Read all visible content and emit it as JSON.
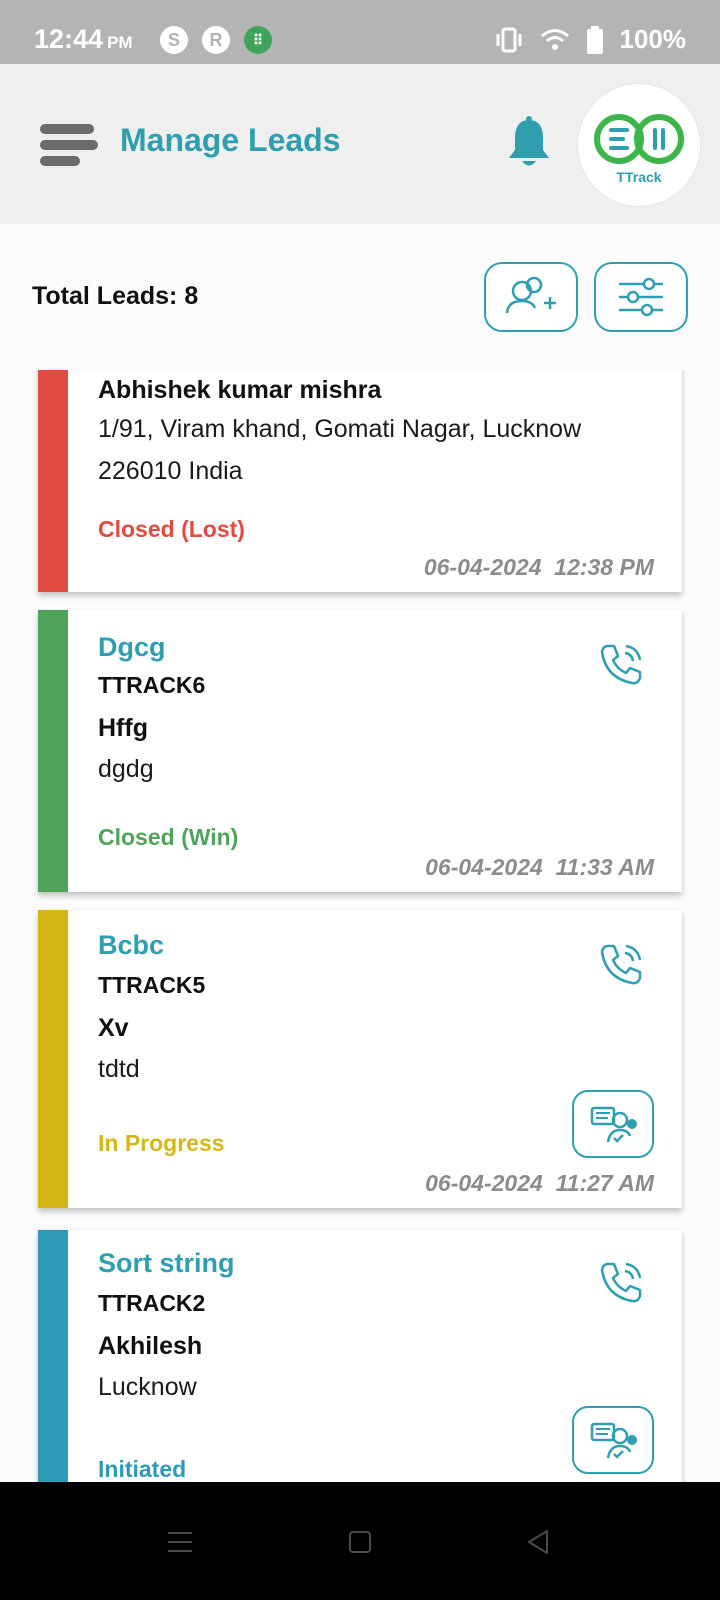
{
  "status_bar": {
    "time": "12:44",
    "ampm": "PM",
    "battery": "100%",
    "notification_icons": [
      "s-app-icon",
      "r-app-icon",
      "green-app-icon"
    ],
    "app_letters": [
      "S",
      "R",
      "⠿"
    ]
  },
  "header": {
    "title": "Manage Leads",
    "logo_text": "TTrack",
    "menu_icon": "hamburger-icon",
    "notification_icon": "bell-icon"
  },
  "toolbar": {
    "total_label": "Total Leads: 8",
    "add_icon": "add-user-icon",
    "filter_icon": "filter-sliders-icon"
  },
  "colors": {
    "accent": "#2f9fb0",
    "lost": "#e24b43",
    "win": "#4fa35b",
    "progress": "#d5b715",
    "initiated": "#2f9ab5"
  },
  "leads": [
    {
      "name": "",
      "code": "",
      "contact": "Abhishek kumar mishra",
      "address": "1/91, Viram khand, Gomati Nagar, Lucknow 226010 India",
      "status": "Closed (Lost)",
      "date": "06-04-2024",
      "time": "12:38 PM",
      "datetime": "06-04-2024  12:38 PM"
    },
    {
      "name": "Dgcg",
      "code": "TTRACK6",
      "contact": "Hffg",
      "address": "dgdg",
      "status": "Closed (Win)",
      "datetime": "06-04-2024  11:33 AM"
    },
    {
      "name": "Bcbc",
      "code": "TTRACK5",
      "contact": "Xv",
      "address": "tdtd",
      "status": "In Progress",
      "datetime": "06-04-2024  11:27 AM"
    },
    {
      "name": "Sort string",
      "code": "TTRACK2",
      "contact": "Akhilesh",
      "address": "Lucknow",
      "status": "Initiated",
      "datetime": ""
    }
  ],
  "nav": {
    "recents_icon": "recents-icon",
    "home_icon": "home-icon",
    "back_icon": "back-icon"
  }
}
